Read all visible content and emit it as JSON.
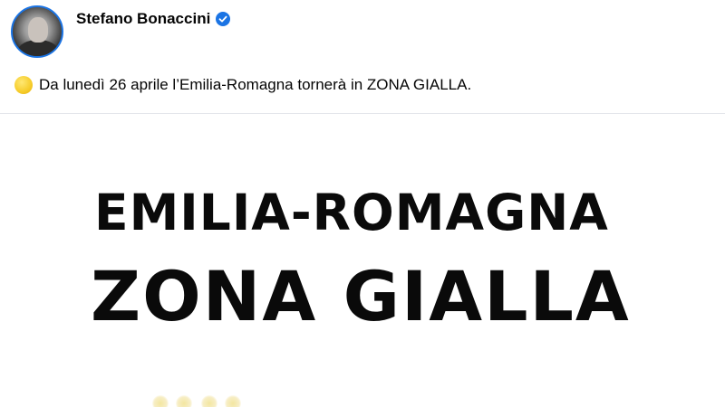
{
  "post": {
    "author": "Stefano Bonaccini",
    "text": "Da lunedì 26 aprile l’Emilia-Romagna tornerà in ZONA GIALLA."
  },
  "image": {
    "line1": "EMILIA-ROMAGNA",
    "line2": "ZONA GIALLA"
  },
  "colors": {
    "verified_badge": "#1b74e4",
    "emoji": "#f6cc2a",
    "text": "#050505",
    "image_text": "#0a0a0a"
  },
  "icons": {
    "verified": "verified-check-icon",
    "emoji": "yellow-circle-emoji"
  }
}
